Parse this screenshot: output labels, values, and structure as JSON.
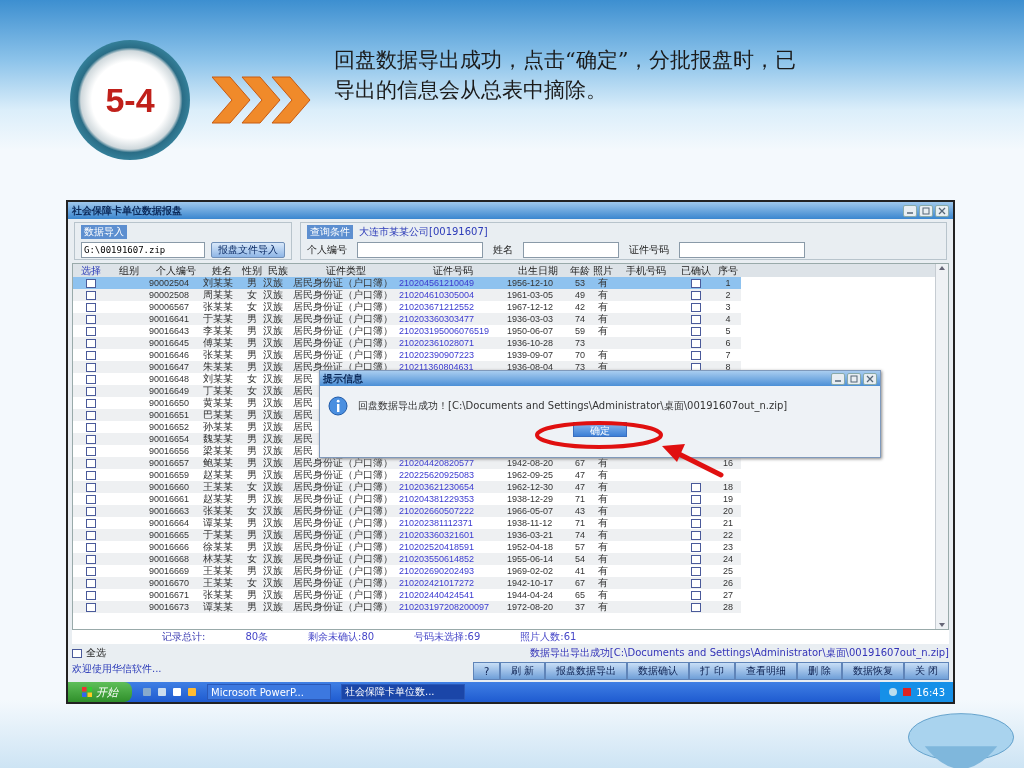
{
  "slide": {
    "badge": "5-4",
    "caption": "回盘数据导出成功，点击“确定”，分批报盘时，已导出的信息会从总表中摘除。"
  },
  "window": {
    "title": "社会保障卡单位数据报盘"
  },
  "import_group": {
    "legend": "数据导入",
    "file_value": "G:\\00191607.zip",
    "button": "报盘文件导入"
  },
  "query_group": {
    "legend": "查询条件",
    "company": "大连市某某公司[00191607]",
    "fields": [
      {
        "label": "个人编号"
      },
      {
        "label": "姓名"
      },
      {
        "label": "证件号码"
      }
    ]
  },
  "table": {
    "columns": [
      "选择",
      "组别",
      "个人编号",
      "姓名",
      "性别",
      "民族",
      "证件类型",
      "证件号码",
      "出生日期",
      "年龄",
      "照片",
      "手机号码",
      "已确认",
      "序号"
    ],
    "rows": [
      {
        "selected": true,
        "checked": false,
        "id": "90002504",
        "name": "刘某某",
        "gender": "男",
        "ethnicity": "汉族",
        "doc_type": "居民身份证（户口簿）",
        "doc_no": "210204561210049",
        "birth": "1956-12-10",
        "age": "53",
        "photo": "有",
        "confirmed": false,
        "seq": "1"
      },
      {
        "selected": false,
        "checked": false,
        "id": "90002508",
        "name": "周某某",
        "gender": "女",
        "ethnicity": "汉族",
        "doc_type": "居民身份证（户口簿）",
        "doc_no": "210204610305004",
        "birth": "1961-03-05",
        "age": "49",
        "photo": "有",
        "confirmed": false,
        "seq": "2"
      },
      {
        "selected": false,
        "checked": false,
        "id": "90006567",
        "name": "张某某",
        "gender": "女",
        "ethnicity": "汉族",
        "doc_type": "居民身份证（户口簿）",
        "doc_no": "210203671212552",
        "birth": "1967-12-12",
        "age": "42",
        "photo": "有",
        "confirmed": false,
        "seq": "3"
      },
      {
        "selected": false,
        "checked": false,
        "id": "90016641",
        "name": "于某某",
        "gender": "男",
        "ethnicity": "汉族",
        "doc_type": "居民身份证（户口簿）",
        "doc_no": "210203360303477",
        "birth": "1936-03-03",
        "age": "74",
        "photo": "有",
        "confirmed": false,
        "seq": "4"
      },
      {
        "selected": false,
        "checked": false,
        "id": "90016643",
        "name": "李某某",
        "gender": "男",
        "ethnicity": "汉族",
        "doc_type": "居民身份证（户口簿）",
        "doc_no": "210203195006076519",
        "birth": "1950-06-07",
        "age": "59",
        "photo": "有",
        "confirmed": false,
        "seq": "5"
      },
      {
        "selected": false,
        "checked": false,
        "id": "90016645",
        "name": "傅某某",
        "gender": "男",
        "ethnicity": "汉族",
        "doc_type": "居民身份证（户口簿）",
        "doc_no": "210202361028071",
        "birth": "1936-10-28",
        "age": "73",
        "confirmed": false,
        "seq": "6"
      },
      {
        "selected": false,
        "checked": false,
        "id": "90016646",
        "name": "张某某",
        "gender": "男",
        "ethnicity": "汉族",
        "doc_type": "居民身份证（户口簿）",
        "doc_no": "210202390907223",
        "birth": "1939-09-07",
        "age": "70",
        "photo": "有",
        "confirmed": false,
        "seq": "7"
      },
      {
        "selected": false,
        "checked": false,
        "id": "90016647",
        "name": "朱某某",
        "gender": "男",
        "ethnicity": "汉族",
        "doc_type": "居民身份证（户口簿）",
        "doc_no": "210211360804631",
        "birth": "1936-08-04",
        "age": "73",
        "photo": "有",
        "confirmed": false,
        "seq": "8"
      },
      {
        "selected": false,
        "checked": false,
        "id": "90016648",
        "name": "刘某某",
        "gender": "女",
        "ethnicity": "汉族",
        "doc_type": "居民"
      },
      {
        "selected": false,
        "checked": false,
        "id": "90016649",
        "name": "丁某某",
        "gender": "女",
        "ethnicity": "汉族",
        "doc_type": "居民"
      },
      {
        "selected": false,
        "checked": false,
        "id": "90016650",
        "name": "黄某某",
        "gender": "男",
        "ethnicity": "汉族",
        "doc_type": "居民"
      },
      {
        "selected": false,
        "checked": false,
        "id": "90016651",
        "name": "巴某某",
        "gender": "男",
        "ethnicity": "汉族",
        "doc_type": "居民"
      },
      {
        "selected": false,
        "checked": false,
        "id": "90016652",
        "name": "孙某某",
        "gender": "男",
        "ethnicity": "汉族",
        "doc_type": "居民"
      },
      {
        "selected": false,
        "checked": false,
        "id": "90016654",
        "name": "魏某某",
        "gender": "男",
        "ethnicity": "汉族",
        "doc_type": "居民"
      },
      {
        "selected": false,
        "checked": false,
        "id": "90016656",
        "name": "梁某某",
        "gender": "男",
        "ethnicity": "汉族",
        "doc_type": "居民"
      },
      {
        "selected": false,
        "checked": false,
        "id": "90016657",
        "name": "鲍某某",
        "gender": "男",
        "ethnicity": "汉族",
        "doc_type": "居民身份证（户口簿）",
        "doc_no": "210204420820577",
        "birth": "1942-08-20",
        "age": "67",
        "photo": "有",
        "seq": "16"
      },
      {
        "selected": false,
        "checked": false,
        "id": "90016659",
        "name": "赵某某",
        "gender": "男",
        "ethnicity": "汉族",
        "doc_type": "居民身份证（户口簿）",
        "doc_no": "220225620925083",
        "birth": "1962-09-25",
        "age": "47",
        "photo": "有"
      },
      {
        "selected": false,
        "checked": false,
        "id": "90016660",
        "name": "王某某",
        "gender": "女",
        "ethnicity": "汉族",
        "doc_type": "居民身份证（户口簿）",
        "doc_no": "210203621230654",
        "birth": "1962-12-30",
        "age": "47",
        "photo": "有",
        "confirmed": false,
        "seq": "18"
      },
      {
        "selected": false,
        "checked": false,
        "id": "90016661",
        "name": "赵某某",
        "gender": "男",
        "ethnicity": "汉族",
        "doc_type": "居民身份证（户口簿）",
        "doc_no": "210204381229353",
        "birth": "1938-12-29",
        "age": "71",
        "photo": "有",
        "confirmed": false,
        "seq": "19"
      },
      {
        "selected": false,
        "checked": false,
        "id": "90016663",
        "name": "张某某",
        "gender": "女",
        "ethnicity": "汉族",
        "doc_type": "居民身份证（户口簿）",
        "doc_no": "210202660507222",
        "birth": "1966-05-07",
        "age": "43",
        "photo": "有",
        "confirmed": false,
        "seq": "20"
      },
      {
        "selected": false,
        "checked": false,
        "id": "90016664",
        "name": "谭某某",
        "gender": "男",
        "ethnicity": "汉族",
        "doc_type": "居民身份证（户口簿）",
        "doc_no": "210202381112371",
        "birth": "1938-11-12",
        "age": "71",
        "photo": "有",
        "confirmed": false,
        "seq": "21"
      },
      {
        "selected": false,
        "checked": false,
        "id": "90016665",
        "name": "于某某",
        "gender": "男",
        "ethnicity": "汉族",
        "doc_type": "居民身份证（户口簿）",
        "doc_no": "210203360321601",
        "birth": "1936-03-21",
        "age": "74",
        "photo": "有",
        "confirmed": false,
        "seq": "22"
      },
      {
        "selected": false,
        "checked": false,
        "id": "90016666",
        "name": "徐某某",
        "gender": "男",
        "ethnicity": "汉族",
        "doc_type": "居民身份证（户口簿）",
        "doc_no": "210202520418591",
        "birth": "1952-04-18",
        "age": "57",
        "photo": "有",
        "confirmed": false,
        "seq": "23"
      },
      {
        "selected": false,
        "checked": false,
        "id": "90016668",
        "name": "林某某",
        "gender": "女",
        "ethnicity": "汉族",
        "doc_type": "居民身份证（户口簿）",
        "doc_no": "210203550614852",
        "birth": "1955-06-14",
        "age": "54",
        "photo": "有",
        "confirmed": false,
        "seq": "24"
      },
      {
        "selected": false,
        "checked": false,
        "id": "90016669",
        "name": "王某某",
        "gender": "男",
        "ethnicity": "汉族",
        "doc_type": "居民身份证（户口簿）",
        "doc_no": "210202690202493",
        "birth": "1969-02-02",
        "age": "41",
        "photo": "有",
        "confirmed": false,
        "seq": "25"
      },
      {
        "selected": false,
        "checked": false,
        "id": "90016670",
        "name": "王某某",
        "gender": "女",
        "ethnicity": "汉族",
        "doc_type": "居民身份证（户口簿）",
        "doc_no": "210202421017272",
        "birth": "1942-10-17",
        "age": "67",
        "photo": "有",
        "confirmed": false,
        "seq": "26"
      },
      {
        "selected": false,
        "checked": false,
        "id": "90016671",
        "name": "张某某",
        "gender": "男",
        "ethnicity": "汉族",
        "doc_type": "居民身份证（户口簿）",
        "doc_no": "210202440424541",
        "birth": "1944-04-24",
        "age": "65",
        "photo": "有",
        "confirmed": false,
        "seq": "27"
      },
      {
        "selected": false,
        "checked": false,
        "id": "90016673",
        "name": "谭某某",
        "gender": "男",
        "ethnicity": "汉族",
        "doc_type": "居民身份证（户口簿）",
        "doc_no": "210203197208200097",
        "birth": "1972-08-20",
        "age": "37",
        "photo": "有",
        "confirmed": false,
        "seq": "28"
      }
    ]
  },
  "summary": [
    {
      "kind": "label",
      "text": "记录总计:"
    },
    {
      "kind": "value",
      "text": "80条"
    },
    {
      "kind": "value",
      "text": "剩余未确认:80"
    },
    {
      "kind": "value",
      "text": "号码未选择:69"
    },
    {
      "kind": "value",
      "text": "照片人数:61"
    }
  ],
  "select_all": {
    "label": "全选",
    "checked": false
  },
  "status_text": "欢迎使用华信软件...",
  "export_message": "数据导出导出成功[C:\\Documents and Settings\\Administrator\\桌面\\00191607out_n.zip]",
  "buttons": [
    "?",
    "刷 新",
    "报盘数据导出",
    "数据确认",
    "打 印",
    "查看明细",
    "删 除",
    "数据恢复",
    "关 闭"
  ],
  "dialog": {
    "title": "提示信息",
    "message": "回盘数据导出成功！[C:\\Documents and Settings\\Administrator\\桌面\\00191607out_n.zip]",
    "button": "确定"
  },
  "taskbar": {
    "start": "开始",
    "tasks": [
      {
        "label": "Microsoft PowerP...",
        "selected": false
      },
      {
        "label": "社会保障卡单位数...",
        "selected": true
      }
    ],
    "clock": "16:43"
  }
}
